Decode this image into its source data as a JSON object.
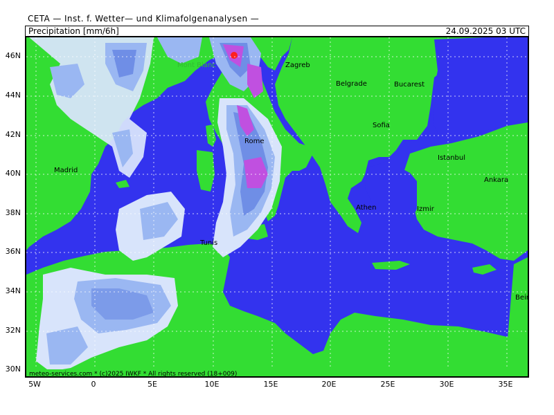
{
  "header": {
    "source": "CETA — Inst. f. Wetter— und Klimafolgenanalysen —",
    "product": "Precipitation [mm/6h]",
    "valid_time": "24.09.2025 03 UTC"
  },
  "footer": {
    "credit": "meteo-services.com * (c)2025 IWKF * All rights reserved (18+009)"
  },
  "axes": {
    "lat_ticks": [
      "46N",
      "44N",
      "42N",
      "40N",
      "38N",
      "36N",
      "34N",
      "32N",
      "30N"
    ],
    "lon_ticks": [
      "5W",
      "0",
      "5E",
      "10E",
      "15E",
      "20E",
      "25E",
      "30E",
      "35E"
    ]
  },
  "cities": [
    {
      "name": "Mont Blanc"
    },
    {
      "name": "Zagreb"
    },
    {
      "name": "Belgrade"
    },
    {
      "name": "Bucarest"
    },
    {
      "name": "Sofia"
    },
    {
      "name": "Istanbul"
    },
    {
      "name": "Madrid"
    },
    {
      "name": "Rome"
    },
    {
      "name": "Ankara"
    },
    {
      "name": "Athen"
    },
    {
      "name": "Izmir"
    },
    {
      "name": "Tunis"
    },
    {
      "name": "Beirut"
    }
  ],
  "colors": {
    "sea": "#3333ee",
    "land": "#33dd33",
    "precip_light": "#d8e4fb",
    "precip_medium": "#9ab7f2",
    "precip_heavy": "#6f8ee6",
    "precip_very_heavy": "#c050e0",
    "precip_extreme": "#ff2020"
  }
}
